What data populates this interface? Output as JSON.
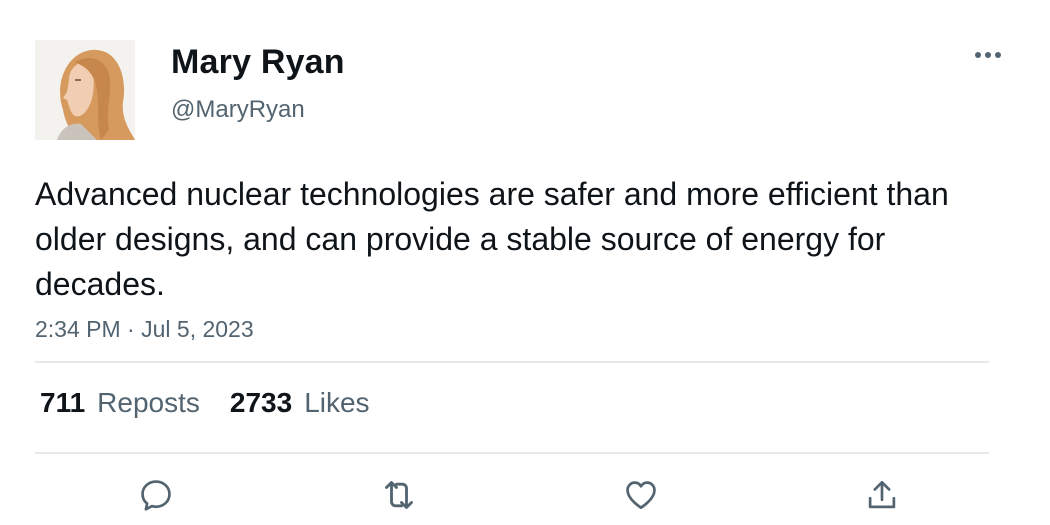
{
  "author": {
    "display_name": "Mary Ryan",
    "handle": "@MaryRyan"
  },
  "tweet": {
    "text": "Advanced nuclear technologies are safer and more efficient than older designs, and can provide a stable source of energy for decades.",
    "time": "2:34 PM",
    "separator": " · ",
    "date": "Jul 5, 2023"
  },
  "stats": {
    "reposts_count": "711",
    "reposts_label": "Reposts",
    "likes_count": "2733",
    "likes_label": "Likes"
  },
  "icons": {
    "more": "more-horizontal-icon",
    "reply": "reply-icon",
    "repost": "repost-icon",
    "like": "heart-icon",
    "share": "share-icon"
  },
  "colors": {
    "text": "#0f1419",
    "secondary": "#536471",
    "divider": "#e6e9eb"
  }
}
